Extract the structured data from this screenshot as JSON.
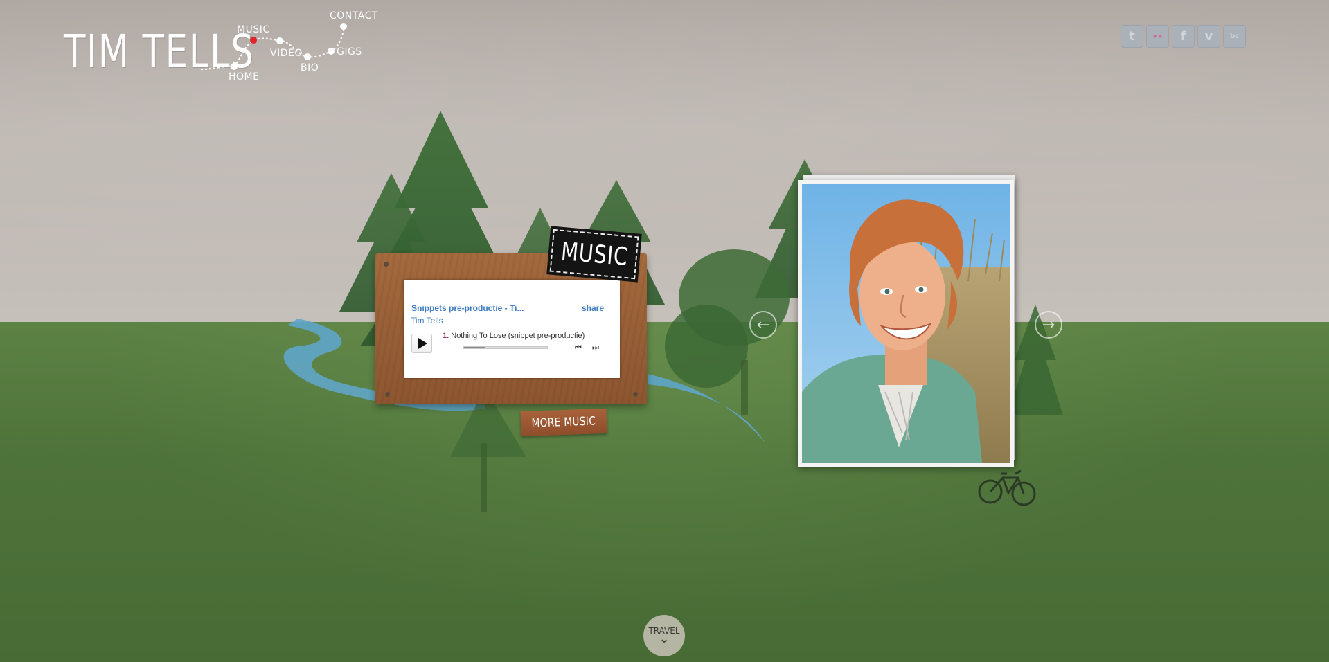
{
  "site": {
    "logo_text": "TIM TELLS"
  },
  "nav": {
    "items": [
      {
        "label": "HOME",
        "active": false
      },
      {
        "label": "MUSIC",
        "active": true
      },
      {
        "label": "VIDEO",
        "active": false
      },
      {
        "label": "BIO",
        "active": false
      },
      {
        "label": "GIGS",
        "active": false
      },
      {
        "label": "CONTACT",
        "active": false
      }
    ],
    "active_color": "#e0262a"
  },
  "social": [
    {
      "name": "twitter",
      "glyph": "t"
    },
    {
      "name": "flickr",
      "glyph": "••"
    },
    {
      "name": "facebook",
      "glyph": "f"
    },
    {
      "name": "vimeo",
      "glyph": "v"
    },
    {
      "name": "bandcamp",
      "glyph": "bc"
    }
  ],
  "music_section": {
    "tag_label": "MUSIC",
    "more_button": "MORE MUSIC",
    "player": {
      "playlist_title": "Snippets pre-productie - Ti...",
      "share_label": "share",
      "artist": "Tim Tells",
      "track_number": "1.",
      "track_title": "Nothing To Lose (snippet pre-productie)",
      "progress": 0.25,
      "prev_label": "⏮",
      "next_label": "⏭"
    }
  },
  "gallery": {
    "prev_arrow": "←",
    "next_arrow": "→"
  },
  "footer": {
    "travel_label": "TRAVEL",
    "travel_icon": "⌄"
  },
  "colors": {
    "sky": "#bdb6b1",
    "grass": "#4f733a",
    "link_blue": "#3d7ac1",
    "river": "#5fa5c8"
  }
}
